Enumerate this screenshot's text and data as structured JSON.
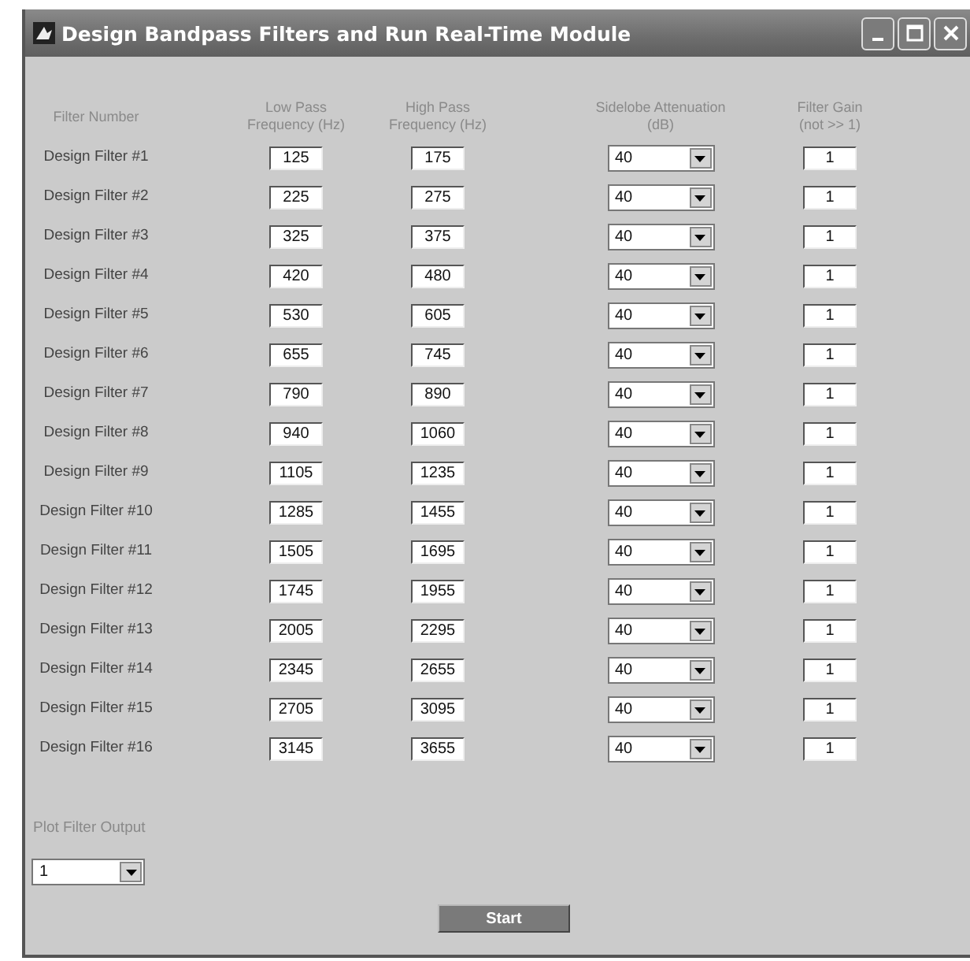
{
  "window": {
    "title": "Design Bandpass Filters and Run Real-Time Module"
  },
  "columns": [
    "Filter Number",
    "Low Pass Frequency (Hz)",
    "High Pass Frequency (Hz)",
    "Sidelobe Attenuation (dB)",
    "Filter Gain (not >> 1)"
  ],
  "filters": [
    {
      "label": "Design Filter #1",
      "low": "125",
      "high": "175",
      "attenuation": "40",
      "gain": "1"
    },
    {
      "label": "Design Filter #2",
      "low": "225",
      "high": "275",
      "attenuation": "40",
      "gain": "1"
    },
    {
      "label": "Design Filter #3",
      "low": "325",
      "high": "375",
      "attenuation": "40",
      "gain": "1"
    },
    {
      "label": "Design Filter #4",
      "low": "420",
      "high": "480",
      "attenuation": "40",
      "gain": "1"
    },
    {
      "label": "Design Filter #5",
      "low": "530",
      "high": "605",
      "attenuation": "40",
      "gain": "1"
    },
    {
      "label": "Design Filter #6",
      "low": "655",
      "high": "745",
      "attenuation": "40",
      "gain": "1"
    },
    {
      "label": "Design Filter #7",
      "low": "790",
      "high": "890",
      "attenuation": "40",
      "gain": "1"
    },
    {
      "label": "Design Filter #8",
      "low": "940",
      "high": "1060",
      "attenuation": "40",
      "gain": "1"
    },
    {
      "label": "Design Filter #9",
      "low": "1105",
      "high": "1235",
      "attenuation": "40",
      "gain": "1"
    },
    {
      "label": "Design Filter #10",
      "low": "1285",
      "high": "1455",
      "attenuation": "40",
      "gain": "1"
    },
    {
      "label": "Design Filter #11",
      "low": "1505",
      "high": "1695",
      "attenuation": "40",
      "gain": "1"
    },
    {
      "label": "Design Filter #12",
      "low": "1745",
      "high": "1955",
      "attenuation": "40",
      "gain": "1"
    },
    {
      "label": "Design Filter #13",
      "low": "2005",
      "high": "2295",
      "attenuation": "40",
      "gain": "1"
    },
    {
      "label": "Design Filter #14",
      "low": "2345",
      "high": "2655",
      "attenuation": "40",
      "gain": "1"
    },
    {
      "label": "Design Filter #15",
      "low": "2705",
      "high": "3095",
      "attenuation": "40",
      "gain": "1"
    },
    {
      "label": "Design Filter #16",
      "low": "3145",
      "high": "3655",
      "attenuation": "40",
      "gain": "1"
    }
  ],
  "plot_output": {
    "label": "Plot Filter Output",
    "value": "1"
  },
  "start_button": "Start"
}
